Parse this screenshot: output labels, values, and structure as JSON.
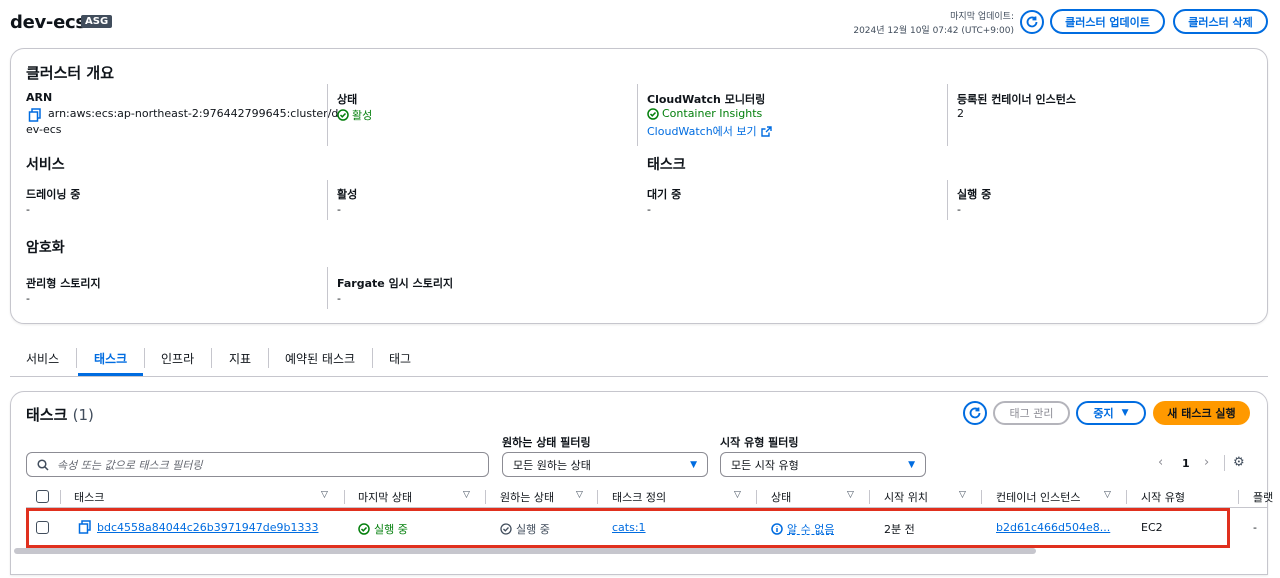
{
  "header": {
    "title": "dev-ecs",
    "badge": "ASG",
    "last_update_label": "마지막 업데이트:",
    "last_update_time": "2024년 12월 10일 07:42 (UTC+9:00)",
    "update_cluster_label": "클러스터 업데이트",
    "delete_cluster_label": "클러스터 삭제"
  },
  "overview": {
    "title": "클러스터 개요",
    "arn_label": "ARN",
    "arn_value_line1": "arn:aws:ecs:ap-northeast-2:976442799645:cluster/d",
    "arn_value_line2": "ev-ecs",
    "status_label": "상태",
    "status_value": "활성",
    "cloudwatch_label": "CloudWatch 모니터링",
    "container_insights": "Container Insights",
    "cloudwatch_link": "CloudWatch에서 보기",
    "registered_label": "등록된 컨테이너 인스턴스",
    "registered_value": "2",
    "services_title": "서비스",
    "draining_label": "드레이닝 중",
    "draining_value": "-",
    "active_label": "활성",
    "active_value": "-",
    "tasks_title": "태스크",
    "pending_label": "대기 중",
    "pending_value": "-",
    "running_label": "실행 중",
    "running_value": "-",
    "encryption_title": "암호화",
    "managed_storage_label": "관리형 스토리지",
    "managed_storage_value": "-",
    "fargate_storage_label": "Fargate 임시 스토리지",
    "fargate_storage_value": "-"
  },
  "tabs": [
    "서비스",
    "태스크",
    "인프라",
    "지표",
    "예약된 태스크",
    "태그"
  ],
  "active_tab": "태스크",
  "tasks_panel": {
    "title": "태스크",
    "count": "(1)",
    "manage_tags_label": "태그 관리",
    "stop_label": "중지",
    "run_new_label": "새 태스크 실행",
    "desired_filter_label": "원하는 상태 필터링",
    "desired_filter_value": "모든 원하는 상태",
    "launch_filter_label": "시작 유형 필터링",
    "launch_filter_value": "모든 시작 유형",
    "search_placeholder": "속성 또는 값으로 태스크 필터링",
    "page_number": "1",
    "columns": [
      "태스크",
      "마지막 상태",
      "원하는 상태",
      "태스크 정의",
      "상태",
      "시작 위치",
      "컨테이너 인스턴스",
      "시작 유형",
      "플랫"
    ],
    "row": {
      "task": "bdc4558a84044c26b3971947de9b1333",
      "last_status": "실행 중",
      "desired_status": "실행 중",
      "task_definition": "cats:1",
      "health": "알 수 없음",
      "started": "2분 전",
      "container_instance": "b2d61c466d504e8...",
      "launch_type": "EC2",
      "platform": "-"
    }
  },
  "colors": {
    "accent": "#006ce0",
    "primary": "#ff9900",
    "success": "#037f0c",
    "highlight": "#e0301e"
  }
}
